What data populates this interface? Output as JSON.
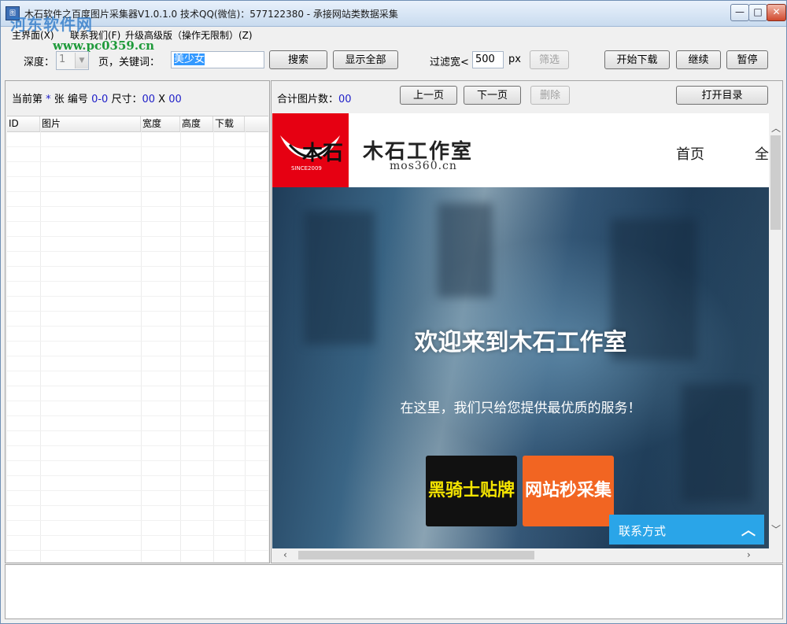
{
  "window": {
    "title": "木石软件之百度图片采集器V1.0.1.0  技术QQ(微信)：577122380   - 承接网站类数据采集",
    "icon_text": "图",
    "min_label": "—",
    "max_label": "□",
    "close_label": "✕"
  },
  "watermark": {
    "brand": "河东软件网",
    "url": "www.pc0359.cn"
  },
  "menu": {
    "items": [
      "主界面(X)",
      "联系我们(F)",
      "升级高级版（操作无限制）(Z)"
    ]
  },
  "toolbar": {
    "depth_label": "深度：",
    "depth_value": "1",
    "page_keyword_label": "页，关键词：",
    "keyword_value": "美少女",
    "search_label": "搜索",
    "show_all_label": "显示全部",
    "filter_label": "过滤宽<",
    "filter_value": "500",
    "filter_unit": "px",
    "filter_button": "筛选",
    "start_download": "开始下载",
    "continue": "继续",
    "pause": "暂停"
  },
  "left_panel": {
    "current_prefix": "当前第",
    "current_value": "*",
    "sheet_label": "张 编号",
    "id_value": "0-0",
    "size_label": "尺寸：",
    "width_value": "00",
    "x_label": "X",
    "height_value": "00",
    "columns": [
      "ID",
      "图片",
      "宽度",
      "高度",
      "下载"
    ]
  },
  "right_panel": {
    "total_label": "合计图片数：",
    "total_value": "00",
    "prev_page": "上一页",
    "next_page": "下一页",
    "delete": "删除",
    "open_dir": "打开目录"
  },
  "site": {
    "logo_text": "木石",
    "logo_since": "SINCE2009",
    "name": "木石工作室",
    "domain": "mos360.cn",
    "nav_home": "首页",
    "nav_all": "全",
    "hero_title": "欢迎来到木石工作室",
    "hero_subtitle": "在这里，我们只给您提供最优质的服务！",
    "cta_black": "黑骑士贴牌",
    "cta_orange": "网站秒采集",
    "contact": "联系方式",
    "colors": {
      "logo_bg": "#e60012",
      "cta_text_yellow": "#f4e400",
      "cta_orange": "#f26522",
      "contact_bg": "#2aa5e8"
    }
  }
}
